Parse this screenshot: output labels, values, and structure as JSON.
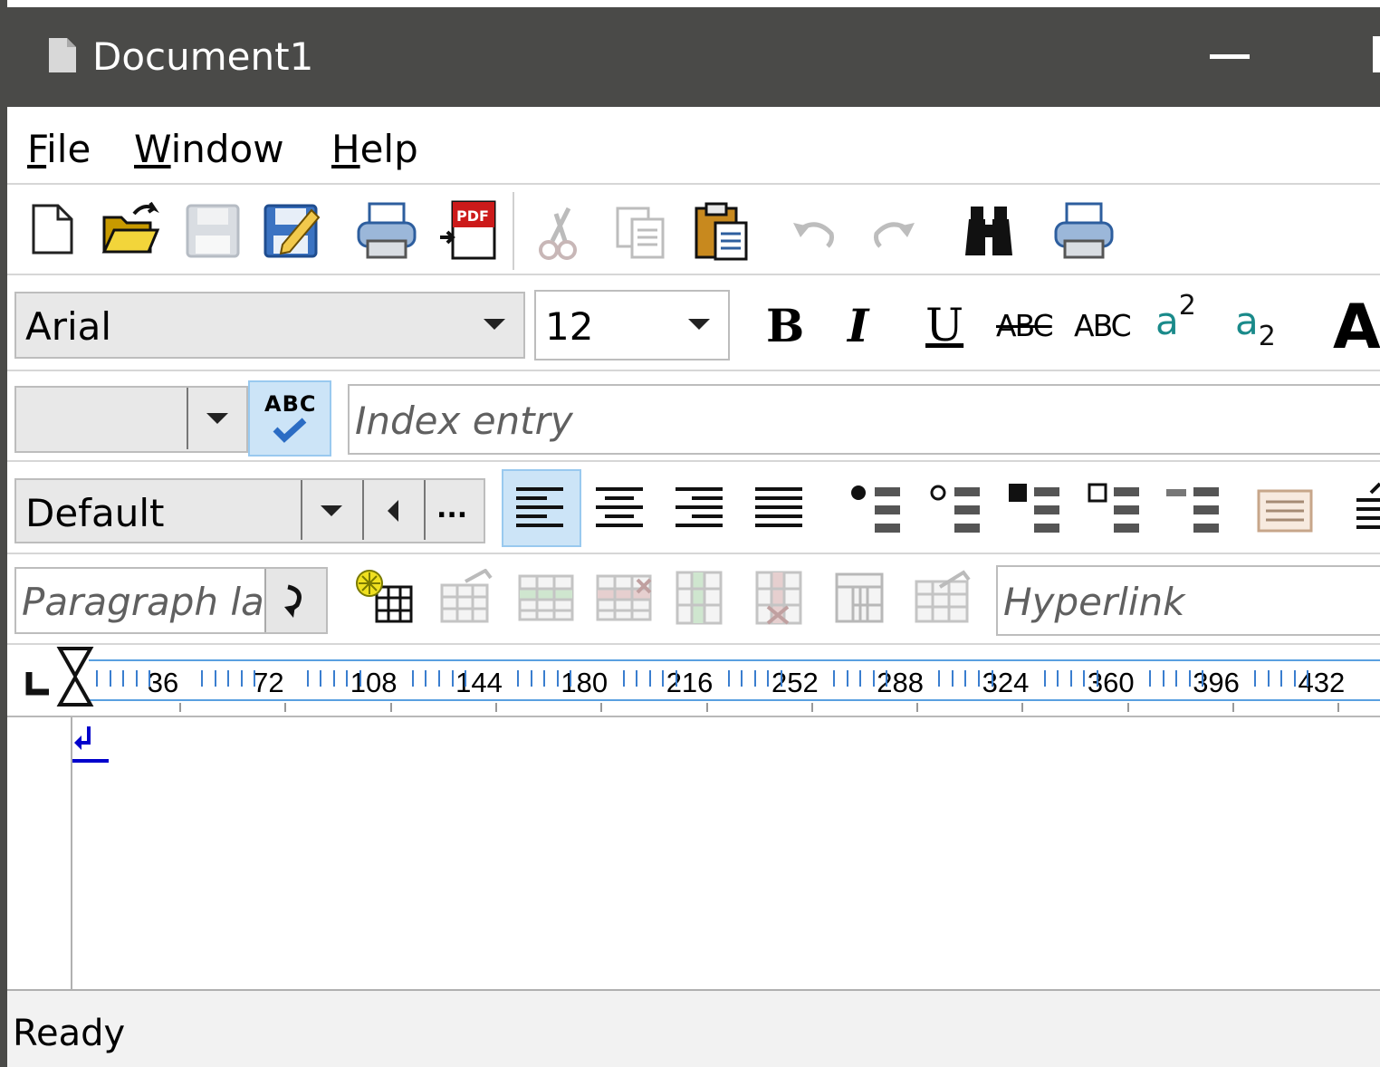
{
  "window": {
    "title": "Document1",
    "minimize_label": ""
  },
  "menu": {
    "file": {
      "accel": "F",
      "rest": "ile"
    },
    "window": {
      "accel": "W",
      "rest": "indow"
    },
    "help": {
      "accel": "H",
      "rest": "elp"
    }
  },
  "toolbar_standard": {
    "icons": [
      "new-document-icon",
      "open-folder-icon",
      "save-icon",
      "save-as-icon",
      "print-icon",
      "export-pdf-icon",
      "cut-icon",
      "copy-icon",
      "paste-icon",
      "undo-icon",
      "redo-icon",
      "find-icon",
      "print-preview-icon"
    ],
    "pdf_label": "PDF"
  },
  "toolbar_font": {
    "font_name": "Arial",
    "font_size": "12",
    "bold": "B",
    "italic": "I",
    "underline": "U",
    "strikeout": "ABC",
    "small_caps": "ABC",
    "superscript_base": "a",
    "superscript_exp": "2",
    "subscript_base": "a",
    "subscript_exp": "2",
    "grow_font": "A"
  },
  "toolbar_spell": {
    "language_value": "",
    "spellcheck_label": "ABC",
    "index_placeholder": "Index entry"
  },
  "toolbar_paragraph": {
    "style_value": "Default",
    "more_label": "...",
    "icons": [
      "align-left-icon",
      "align-center-icon",
      "align-right-icon",
      "justify-icon",
      "bullet-filled-icon",
      "bullet-hollow-icon",
      "bullet-square-icon",
      "bullet-hollow-square-icon",
      "bullet-dash-icon",
      "frame-icon",
      "line-spacing-icon"
    ]
  },
  "toolbar_table": {
    "paragraph_label_placeholder": "Paragraph la",
    "hyperlink_placeholder": "Hyperlink",
    "icons": [
      "insert-table-icon",
      "table-properties-icon",
      "insert-row-icon",
      "delete-row-icon",
      "insert-column-icon",
      "delete-column-icon",
      "split-cells-icon",
      "table-format-icon"
    ]
  },
  "ruler": {
    "labels": [
      "36",
      "72",
      "108",
      "144",
      "180",
      "216",
      "252",
      "288",
      "324",
      "360",
      "396",
      "432"
    ]
  },
  "status": {
    "text": "Ready"
  },
  "colors": {
    "titlebar": "#4a4a48",
    "ruler_accent": "#3a7ecf",
    "selected_button": "#cce4f7",
    "paragraph_mark": "#0000cc"
  }
}
